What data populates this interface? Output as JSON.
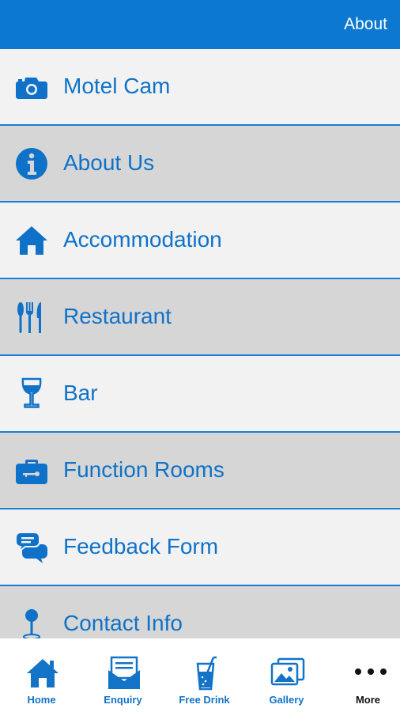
{
  "header": {
    "title": "About"
  },
  "menu": {
    "items": [
      {
        "label": "Motel Cam",
        "icon": "camera-icon"
      },
      {
        "label": "About Us",
        "icon": "info-icon"
      },
      {
        "label": "Accommodation",
        "icon": "home-icon"
      },
      {
        "label": "Restaurant",
        "icon": "cutlery-icon"
      },
      {
        "label": "Bar",
        "icon": "wine-glass-icon"
      },
      {
        "label": "Function Rooms",
        "icon": "briefcase-key-icon"
      },
      {
        "label": "Feedback Form",
        "icon": "chat-bubbles-icon"
      },
      {
        "label": "Contact Info",
        "icon": "map-pin-icon"
      }
    ]
  },
  "tabbar": {
    "tabs": [
      {
        "label": "Home",
        "icon": "home-icon"
      },
      {
        "label": "Enquiry",
        "icon": "envelope-icon"
      },
      {
        "label": "Free Drink",
        "icon": "drink-glass-icon"
      },
      {
        "label": "Gallery",
        "icon": "photos-icon"
      },
      {
        "label": "More",
        "icon": "more-dots-icon"
      }
    ]
  },
  "colors": {
    "accent": "#0d78d0",
    "text_blue": "#0f72c8",
    "row_alt": "#d6d6d6",
    "row_light": "#f2f2f2"
  }
}
